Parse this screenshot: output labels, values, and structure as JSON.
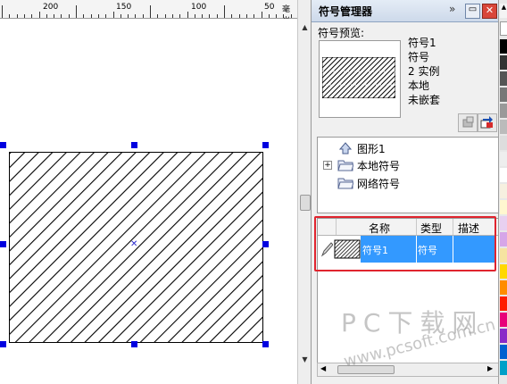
{
  "ruler": {
    "labels": [
      "200",
      "150",
      "100",
      "50"
    ],
    "unit": "毫米"
  },
  "docker": {
    "title": "符号管理器",
    "preview_label": "符号预览:",
    "info": [
      "符号1",
      "符号",
      "2 实例",
      "本地",
      "未嵌套"
    ]
  },
  "tree": [
    {
      "label": "图形1",
      "icon": "shape-icon"
    },
    {
      "label": "本地符号",
      "icon": "folder-icon",
      "expandable": true
    },
    {
      "label": "网络符号",
      "icon": "folder-icon"
    }
  ],
  "table": {
    "columns": [
      "名称",
      "类型",
      "描述"
    ],
    "rows": [
      {
        "name": "符号1",
        "type": "符号",
        "description": ""
      }
    ]
  },
  "watermark": {
    "title": "PC下载网",
    "url": "www.pcsoft.com.cn"
  },
  "colors": {
    "selection": "#3399ff",
    "handle": "#0000e0",
    "highlight": "#e0242e"
  }
}
